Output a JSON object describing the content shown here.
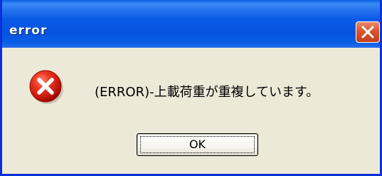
{
  "window": {
    "title": "error"
  },
  "dialog": {
    "message": "(ERROR)-上載荷重が重複しています。",
    "ok_label": "OK"
  },
  "icons": {
    "error": "error-x-icon",
    "close": "close-icon"
  },
  "colors": {
    "titlebar": "#0a5fe6",
    "close_button": "#d8552e",
    "dialog_bg": "#ece9d8",
    "error_icon": "#e02b1e"
  }
}
